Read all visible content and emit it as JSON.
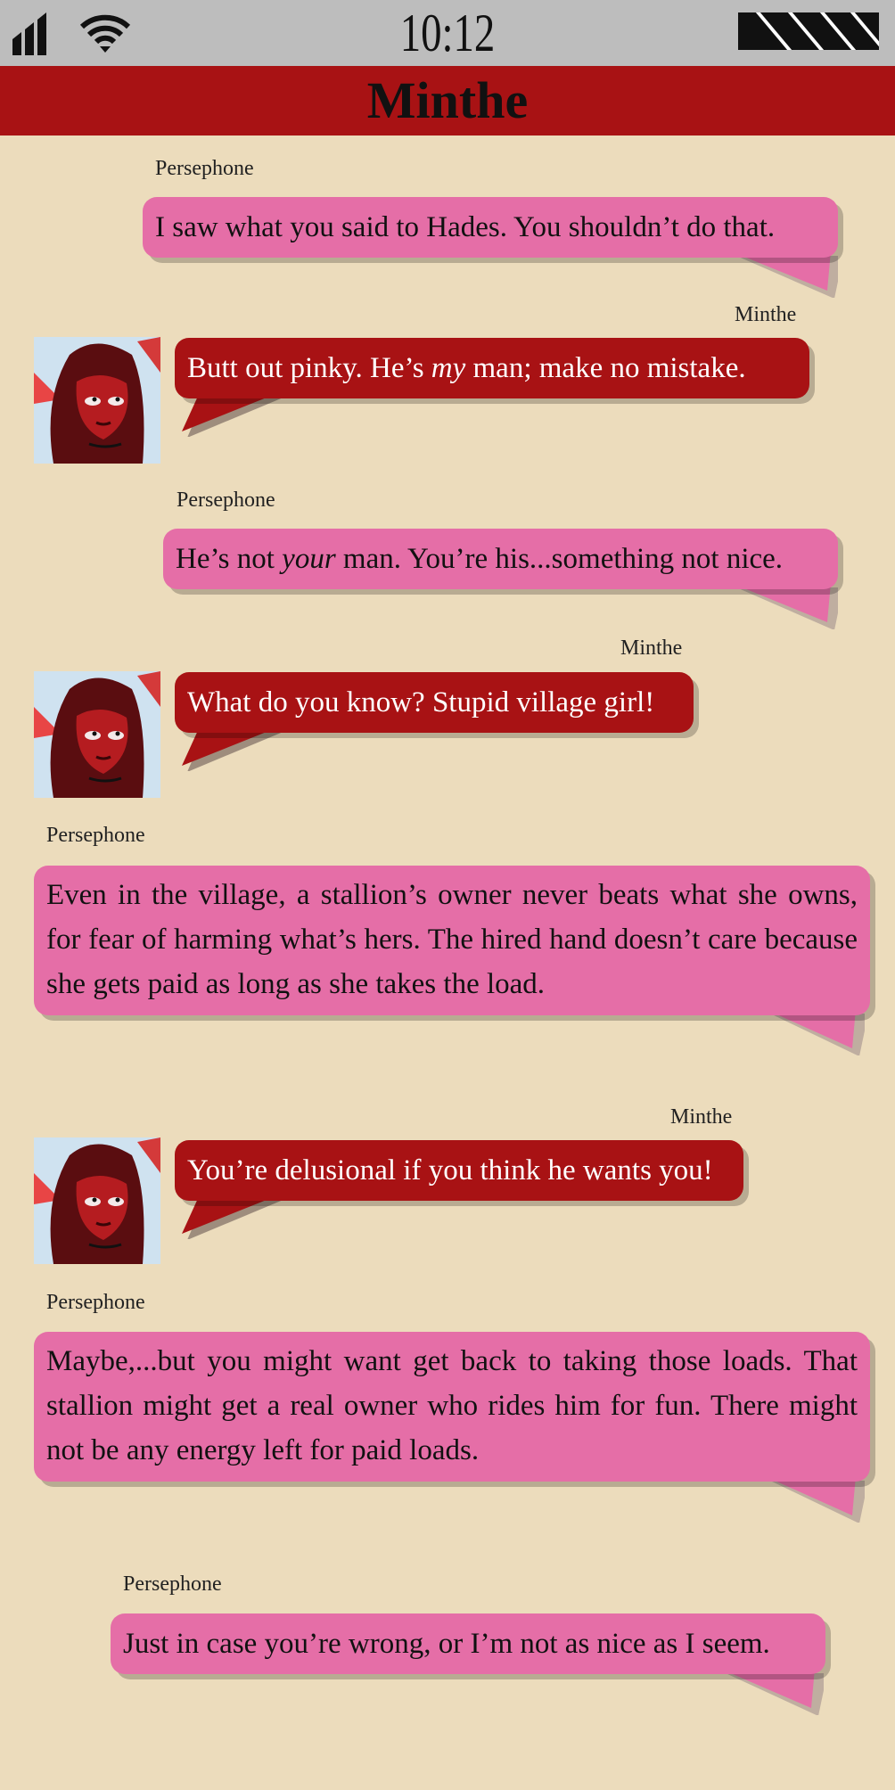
{
  "status": {
    "time": "10:12",
    "signal_icon": "signal-bars-icon",
    "wifi_icon": "wifi-icon",
    "battery_icon": "battery-icon"
  },
  "header": {
    "title": "Minthe"
  },
  "colors": {
    "background": "#ecdcbc",
    "header": "#a81214",
    "status_bar": "#bdbdbd",
    "persephone_bubble": "#e56ea7",
    "minthe_bubble": "#a81214"
  },
  "messages": [
    {
      "sender": "Persephone",
      "text": "I saw what you said to Hades.  You shouldn’t do that."
    },
    {
      "sender": "Minthe",
      "text_before": "Butt out pinky.  He’s ",
      "text_em": "my",
      "text_after": " man; make no mistake."
    },
    {
      "sender": "Persephone",
      "text_before": "He’s not ",
      "text_em": "your",
      "text_after": " man.  You’re his...something not nice."
    },
    {
      "sender": "Minthe",
      "text": "What do you know?  Stupid village girl!"
    },
    {
      "sender": "Persephone",
      "text": "Even in the village, a stallion’s owner never beats what she owns, for fear of harming what’s hers.  The hired hand doesn’t care because she gets paid as long as she takes the load."
    },
    {
      "sender": "Minthe",
      "text": "You’re delusional if you think he wants you!"
    },
    {
      "sender": "Persephone",
      "text": "Maybe,...but you might want get back to taking those loads.  That stallion might get a real owner who rides him for fun.  There might not be any energy left for paid loads."
    },
    {
      "sender": "Persephone",
      "text": "Just in case you’re wrong, or I’m not as nice as I seem."
    }
  ]
}
